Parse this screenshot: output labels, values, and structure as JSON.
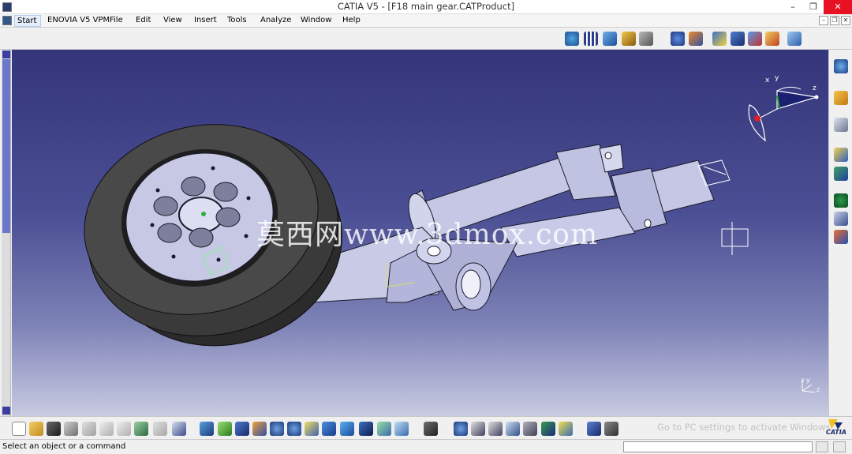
{
  "window": {
    "title": "CATIA V5 - [F18 main gear.CATProduct]",
    "controls": [
      "–",
      "❐",
      "✕"
    ]
  },
  "menu": {
    "items": [
      "Start",
      "ENOVIA V5 VPM",
      "File",
      "Edit",
      "View",
      "Insert",
      "Tools",
      "Analyze",
      "Window",
      "Help"
    ]
  },
  "viewport": {
    "watermark": "莫西网www.3dmox.com",
    "compass_labels": {
      "x": "x",
      "y": "y",
      "z": "z"
    },
    "axis_labels": {
      "x": "x",
      "y": "y",
      "z": "z"
    }
  },
  "overlay": {
    "activate_windows": "Go to PC settings to activate Windows."
  },
  "status": {
    "message": "Select an object or a command"
  },
  "brand": {
    "logo_text": "CATIA"
  },
  "icons": {
    "top_toolbar": [
      "workbench-icon",
      "grid-icon",
      "product-icon",
      "assembly-icon",
      "tools-icon",
      "rotate-icon",
      "update-icon",
      "snap-icon",
      "anchor-icon",
      "constraint-icon",
      "explode-icon",
      "manipulate-icon"
    ],
    "right_toolbar": [
      "compass-icon",
      "select-arrow-icon",
      "measure-icon",
      "material-icon",
      "parts-icon",
      "spiral-icon",
      "catalog-icon",
      "clash-icon"
    ],
    "bottom_toolbar": [
      "new-icon",
      "open-icon",
      "save-icon",
      "print-icon",
      "cut-icon",
      "copy-icon",
      "paste-icon",
      "undo-icon",
      "redo-icon",
      "whats-this-icon",
      "fly-mode-icon",
      "fit-all-icon",
      "pan-icon",
      "rotate-view-icon",
      "zoom-in-icon",
      "zoom-out-icon",
      "normal-view-icon",
      "multi-view-icon",
      "iso-view-icon",
      "render-style-icon",
      "hide-show-icon",
      "swap-space-icon",
      "capture-icon",
      "catalog-browser-icon",
      "previous-icon",
      "next-icon",
      "zoom-area-icon",
      "sectioning-icon",
      "lighting-icon",
      "depth-effect-icon",
      "ground-icon",
      "magnifier-icon"
    ]
  },
  "colors": {
    "viewport_top": "#34357a",
    "viewport_bottom": "#c9cbe2",
    "tire": "#2b2b2b",
    "rim": "#c6c8e4",
    "strut": "#c5c7e5",
    "close_button": "#e81123"
  }
}
